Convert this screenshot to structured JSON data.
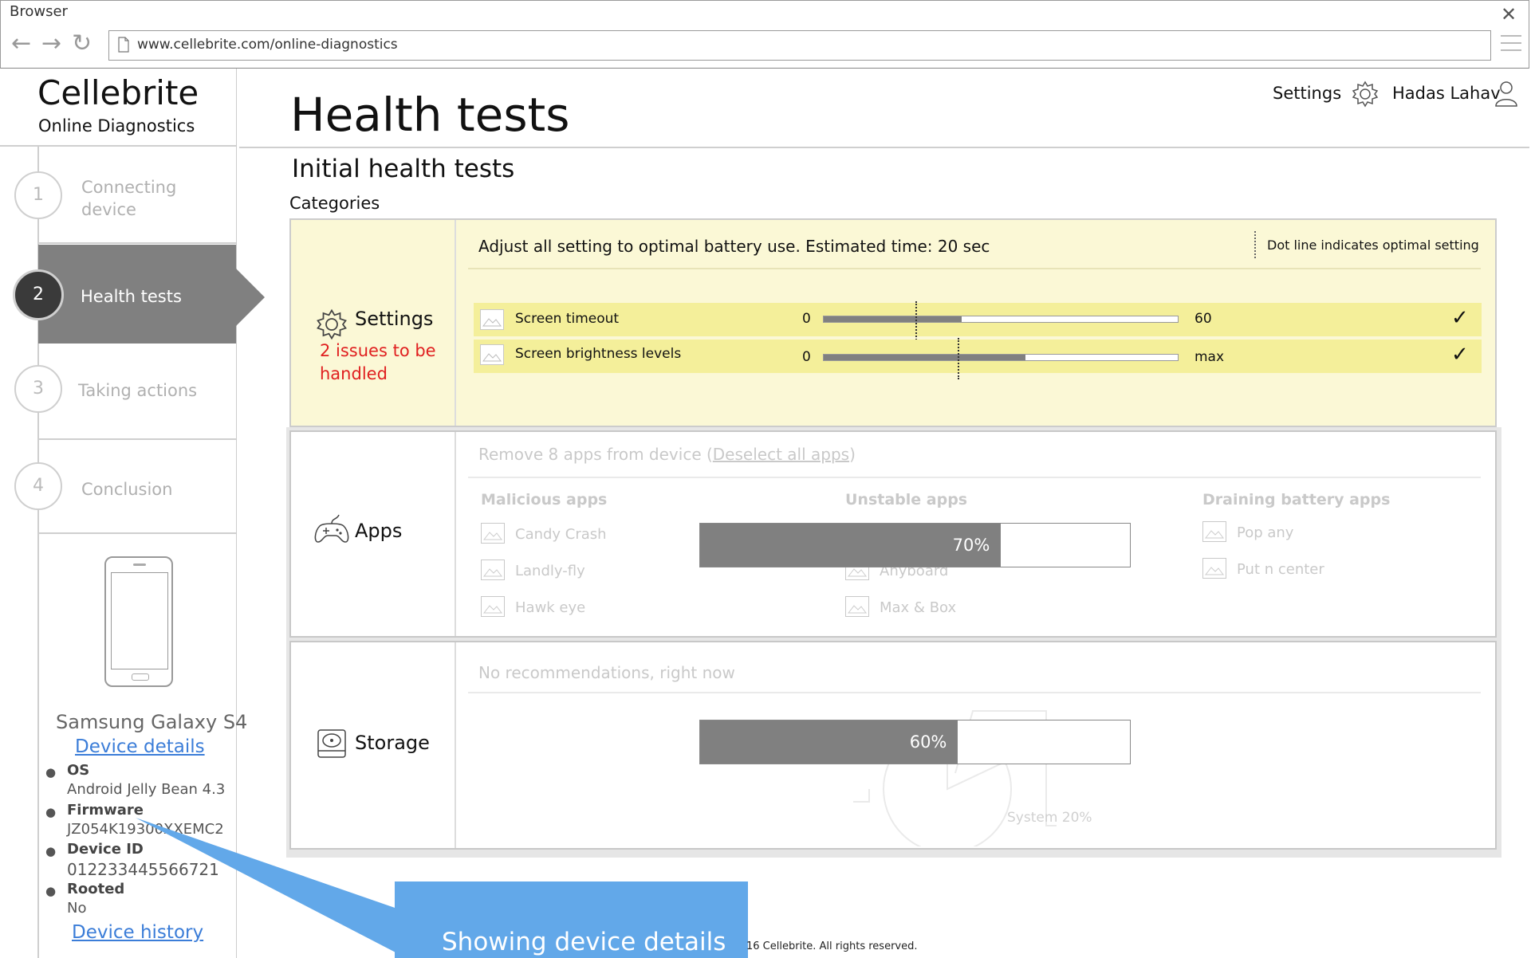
{
  "browser": {
    "title": "Browser",
    "url": "www.cellebrite.com/online-diagnostics",
    "back_icon": "←",
    "forward_icon": "→",
    "reload_icon": "↻",
    "close_icon": "✕"
  },
  "brand": {
    "name": "Cellebrite",
    "subtitle": "Online Diagnostics"
  },
  "steps": [
    {
      "number": "1",
      "label_line1": "Connecting",
      "label_line2": "device"
    },
    {
      "number": "2",
      "label": "Health tests"
    },
    {
      "number": "3",
      "label": "Taking actions"
    },
    {
      "number": "4",
      "label": "Conclusion"
    }
  ],
  "device": {
    "name": "Samsung Galaxy S4",
    "details_link": "Device details",
    "os_label": "OS",
    "os_value": "Android Jelly Bean 4.3",
    "firmware_label": "Firmware",
    "firmware_value": "JZ054K19300XXEMC2",
    "device_id_label": "Device ID",
    "device_id_value": "012233445566721",
    "rooted_label": "Rooted",
    "rooted_value": "No",
    "history_link": "Device history"
  },
  "header": {
    "page_title": "Health tests",
    "settings_label": "Settings",
    "user_name": "Hadas Lahav",
    "subtitle": "Initial health tests",
    "categories_label": "Categories"
  },
  "settings_panel": {
    "name": "Settings",
    "issues_line1": "2 issues to be",
    "issues_line2": "handled",
    "description": "Adjust all setting to optimal battery use. Estimated time: 20 sec",
    "legend": "Dot line indicates optimal setting",
    "rows": [
      {
        "label": "Screen timeout",
        "min": "0",
        "max": "60",
        "value_fraction": 0.39,
        "optimal_fraction": 0.26,
        "check": "✓"
      },
      {
        "label": "Screen brightness levels",
        "min": "0",
        "max": "max",
        "value_fraction": 0.57,
        "optimal_fraction": 0.38,
        "check": "✓"
      }
    ]
  },
  "apps_panel": {
    "name": "Apps",
    "description_prefix": "Remove 8 apps from device (",
    "deselect_link": "Deselect all apps",
    "description_suffix": ")",
    "columns": [
      {
        "heading": "Malicious apps",
        "items": [
          "Candy Crash",
          "Landly-fly",
          "Hawk eye"
        ]
      },
      {
        "heading": "Unstable apps",
        "items": [
          "Anyboard",
          "Max & Box"
        ]
      },
      {
        "heading": "Draining battery apps",
        "items": [
          "Pop any",
          "Put n center"
        ]
      }
    ],
    "progress_percent": 70,
    "progress_label": "70%"
  },
  "storage_panel": {
    "name": "Storage",
    "description": "No recommendations, right now",
    "progress_percent": 60,
    "progress_label": "60%",
    "pie_label_system": "System 20%"
  },
  "callout": {
    "text": "Showing device details"
  },
  "footer": {
    "text": "16 Cellebrite. All rights reserved."
  }
}
